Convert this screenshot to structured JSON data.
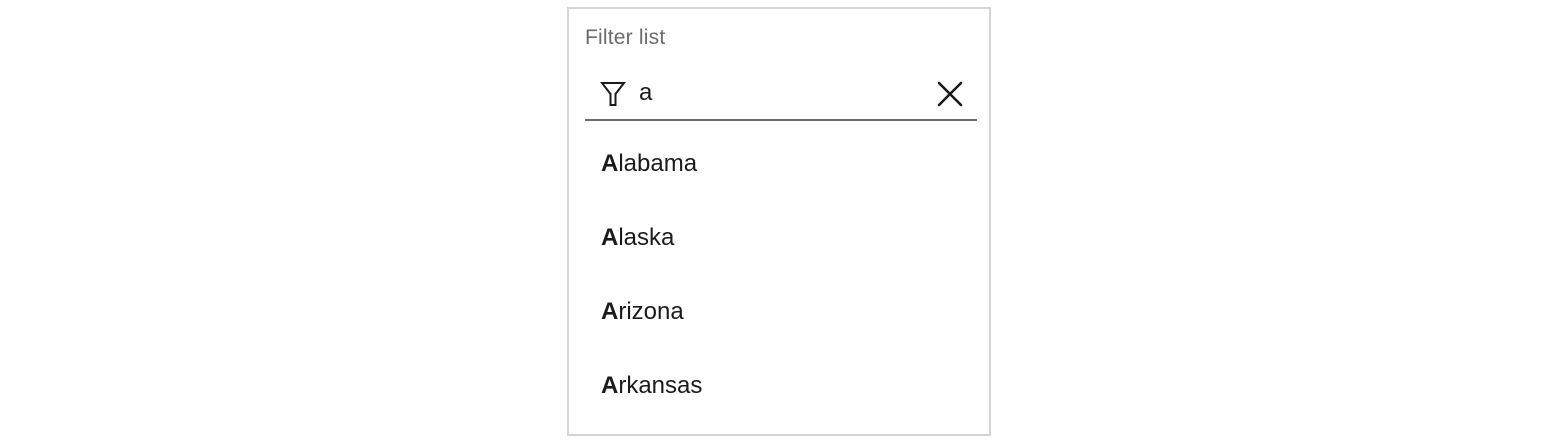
{
  "filter": {
    "label": "Filter list",
    "value": "a",
    "filter_icon": "funnel-icon",
    "clear_icon": "close-icon"
  },
  "results": [
    {
      "match": "A",
      "rest": "labama"
    },
    {
      "match": "A",
      "rest": "laska"
    },
    {
      "match": "A",
      "rest": "rizona"
    },
    {
      "match": "A",
      "rest": "rkansas"
    }
  ],
  "colors": {
    "border": "#d4d4d4",
    "label": "#6b6b6b",
    "text": "#1b1b1b"
  }
}
